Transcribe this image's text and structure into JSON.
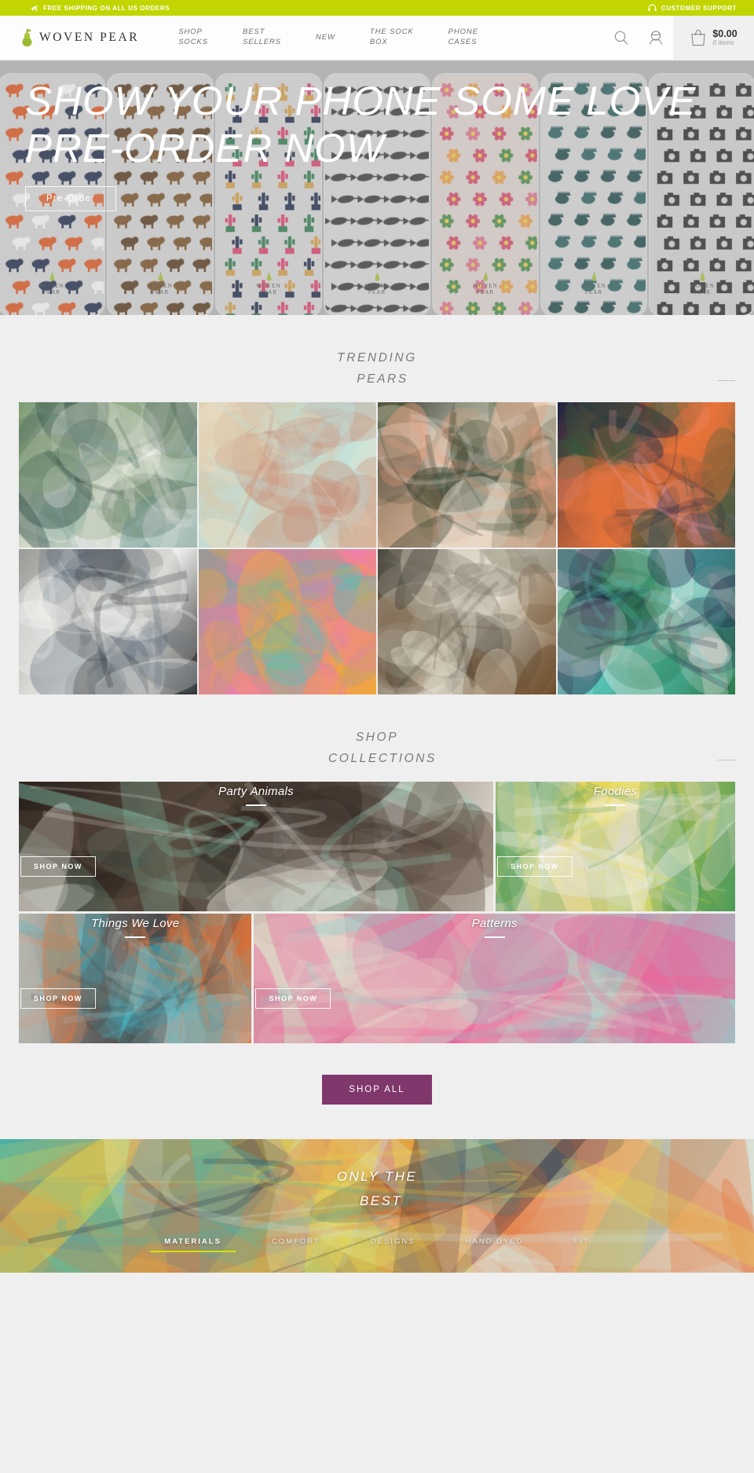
{
  "announce": {
    "left": {
      "icon": "airplane-icon",
      "text": "FREE SHIPPING ON ALL US ORDERS"
    },
    "right": {
      "icon": "headset-icon",
      "text": "CUSTOMER SUPPORT"
    },
    "bg": "#c2d500"
  },
  "header": {
    "brand": "WOVEN PEAR",
    "logo_icon": "pear-logo-icon",
    "nav": [
      {
        "label": "SHOP\nSOCKS"
      },
      {
        "label": "BEST\nSELLERS"
      },
      {
        "label": "NEW"
      },
      {
        "label": "THE SOCK\nBOX"
      },
      {
        "label": "PHONE\nCASES"
      }
    ],
    "search_icon": "search-icon",
    "account_icon": "account-icon",
    "cart": {
      "icon": "shopping-bag-icon",
      "price": "$0.00",
      "count": "0 items"
    }
  },
  "hero": {
    "title_line1": "SHOW YOUR PHONE SOME LOVE",
    "title_line2": "PRE-ORDER NOW",
    "button": "Pre-Order",
    "case_logo_top": "WOVEN",
    "case_logo_bottom": "PEAR",
    "cases": [
      {
        "name": "foxes",
        "bg": "#dadada",
        "motif": "fox",
        "colors": [
          "#e2561f",
          "#1d2a4a",
          "#ffffff"
        ]
      },
      {
        "name": "bison",
        "bg": "#d8d8d8",
        "motif": "bison",
        "colors": [
          "#5a3a1c",
          "#7a4f24"
        ]
      },
      {
        "name": "cactus",
        "bg": "#dcdcdc",
        "motif": "cactus",
        "colors": [
          "#2f7d4f",
          "#e0446f",
          "#d8a24a",
          "#1d2a4a"
        ]
      },
      {
        "name": "narwhal",
        "bg": "#dedede",
        "motif": "narwhal",
        "colors": [
          "#3a3a3a"
        ]
      },
      {
        "name": "floral",
        "bg": "#e4d9d5",
        "motif": "floral",
        "colors": [
          "#e2748f",
          "#f0a24a",
          "#4a8f4a",
          "#d84a6a"
        ]
      },
      {
        "name": "hedgehog",
        "bg": "#dcdcdc",
        "motif": "hedgehog",
        "colors": [
          "#1f4a4a",
          "#2a6060"
        ]
      },
      {
        "name": "camera",
        "bg": "#d6d6d6",
        "motif": "camera",
        "colors": [
          "#2a2a2a"
        ]
      }
    ]
  },
  "trending": {
    "heading_line1": "TRENDING",
    "heading_line2": "PEARS",
    "items": [
      {
        "name": "cactus-socks-on-fur",
        "tones": [
          "#7d9c72",
          "#f2f0ea",
          "#6f9b94",
          "#2c4a42"
        ]
      },
      {
        "name": "pastel-socks-on-wood",
        "tones": [
          "#d9c6a8",
          "#bfe2dd",
          "#f2e3c8",
          "#c98f7a"
        ]
      },
      {
        "name": "camp-socks-sandals",
        "tones": [
          "#2f3a2a",
          "#e8e0d2",
          "#f0a07f",
          "#4a5a3a"
        ]
      },
      {
        "name": "la-vie-en-rose-socks",
        "tones": [
          "#1c2340",
          "#e8743a",
          "#2f5a3a",
          "#e8a0b0"
        ]
      },
      {
        "name": "face-print-socks-sneakers",
        "tones": [
          "#9a9a96",
          "#f0f0ee",
          "#222222",
          "#5a6a78"
        ]
      },
      {
        "name": "bright-pink-yellow-socks",
        "tones": [
          "#9a9a96",
          "#ef7fa8",
          "#f0a93a",
          "#49c3c0"
        ]
      },
      {
        "name": "bison-socks-on-stone",
        "tones": [
          "#4a463c",
          "#efe8d8",
          "#6a4a2a",
          "#8a8272"
        ]
      },
      {
        "name": "prickly-pear-socks",
        "tones": [
          "#e8e6df",
          "#55c6bd",
          "#2f7d4f",
          "#1c2340"
        ]
      }
    ]
  },
  "collections": {
    "heading_line1": "SHOP",
    "heading_line2": "COLLECTIONS",
    "shop_now_label": "SHOP NOW",
    "cards": [
      {
        "title": "Party Animals",
        "name": "party-animals",
        "tones": [
          "#2a211c",
          "#6a5a4a",
          "#e8e4dc",
          "#8fd8c0"
        ]
      },
      {
        "title": "Foodies",
        "name": "foodies",
        "tones": [
          "#d8d4cc",
          "#e8d84a",
          "#4a9a5a",
          "#f0f0ee"
        ]
      },
      {
        "title": "Things We Love",
        "name": "things-we-love",
        "tones": [
          "#b8b8b0",
          "#4a4a4a",
          "#e8763a",
          "#49b8c8"
        ]
      },
      {
        "title": "Patterns",
        "name": "patterns",
        "tones": [
          "#c8b8ae",
          "#ef5f9a",
          "#8fd8d0",
          "#e8e0d0"
        ]
      }
    ],
    "shop_all_label": "SHOP ALL",
    "shop_all_color": "#80376b"
  },
  "feature": {
    "title_line1": "ONLY THE",
    "title_line2": "BEST",
    "tabs": [
      {
        "label": "MATERIALS",
        "active": true
      },
      {
        "label": "COMFORT",
        "active": false
      },
      {
        "label": "DESIGNS",
        "active": false
      },
      {
        "label": "HAND DYED",
        "active": false
      },
      {
        "label": "FIT",
        "active": false
      }
    ],
    "active_underline": "#d7e100",
    "tones": [
      "#49b0a8",
      "#e8763a",
      "#d8e8e0",
      "#1c2340",
      "#e8d84a"
    ]
  }
}
